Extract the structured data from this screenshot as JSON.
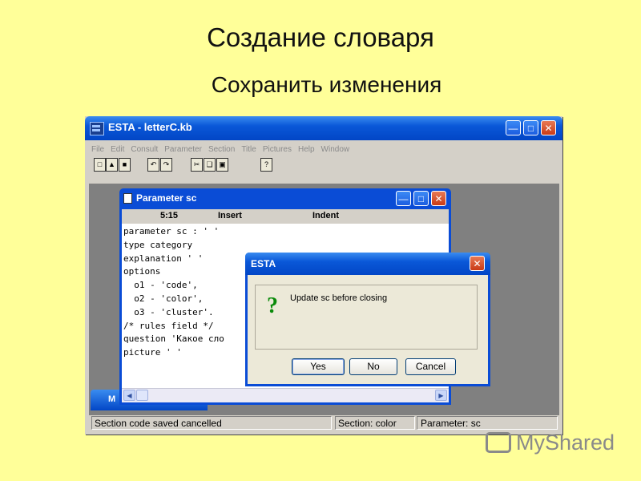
{
  "slide": {
    "title": "Создание словаря",
    "subtitle": "Сохранить изменения"
  },
  "app": {
    "title": "ESTA - letterC.kb",
    "menu": [
      "File",
      "Edit",
      "Consult",
      "Parameter",
      "Section",
      "Title",
      "Pictures",
      "Help",
      "Window"
    ],
    "toolbar_icons": [
      "new-file-icon",
      "open-icon",
      "save-icon",
      "undo-icon",
      "redo-icon",
      "cut-icon",
      "copy-icon",
      "paste-icon",
      "help-icon"
    ],
    "status": {
      "message": "Section code saved  cancelled",
      "section": "Section: color",
      "parameter": "Parameter: sc"
    }
  },
  "child_window": {
    "title": "Parameter sc",
    "position": "5:15",
    "mode": "Insert",
    "indent": "Indent",
    "code_lines": [
      "parameter sc : ' '",
      "type category",
      "explanation ' '",
      "options",
      "  o1 - 'code',",
      "  o2 - 'color',",
      "  o3 - 'cluster'.",
      "/* rules field */",
      "question 'Какое сло",
      "picture ' '"
    ]
  },
  "minimized_window": {
    "label": "M"
  },
  "dialog": {
    "title": "ESTA",
    "message": "Update sc before closing",
    "buttons": {
      "yes": "Yes",
      "no": "No",
      "cancel": "Cancel"
    }
  },
  "watermark": {
    "text": "MyShared"
  }
}
